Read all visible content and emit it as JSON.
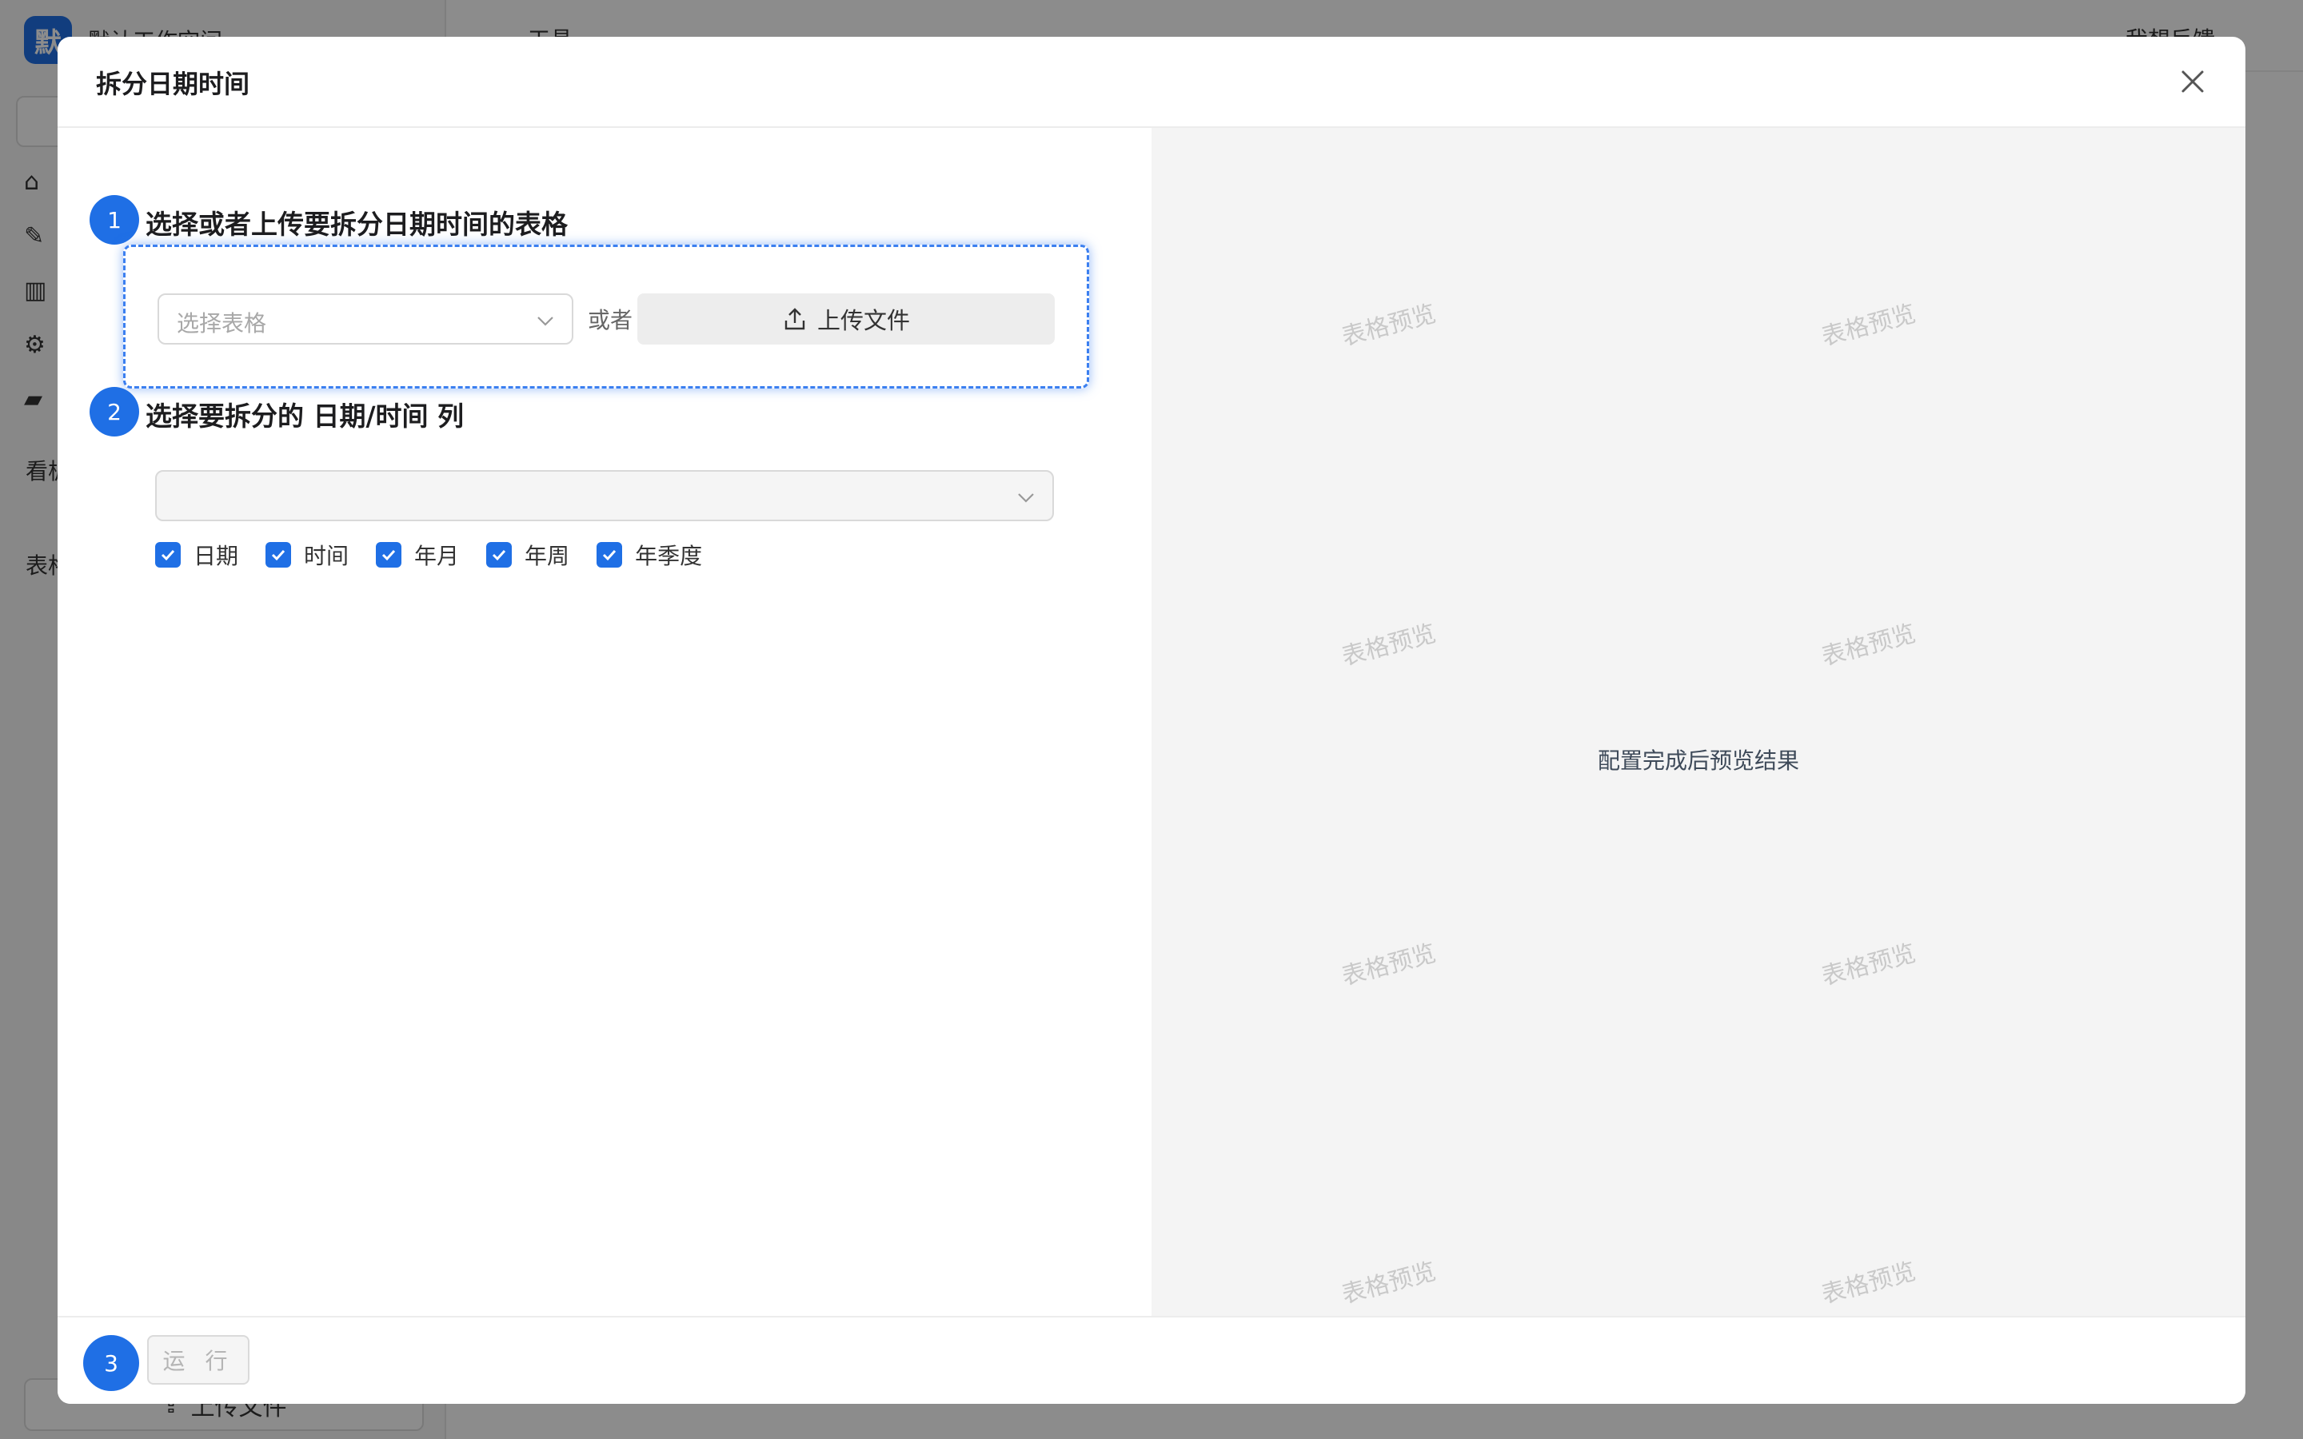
{
  "background": {
    "workspace_logo": "默",
    "workspace_name": "默认工作空间",
    "topbar_label": "工具",
    "feedback": "我想反馈",
    "section_boards": "看板",
    "section_tables": "表格",
    "bottom_upload": "上传文件"
  },
  "modal": {
    "title": "拆分日期时间",
    "step1": {
      "number": "1",
      "title": "选择或者上传要拆分日期时间的表格"
    },
    "select_table_placeholder": "选择表格",
    "or_text": "或者",
    "upload_button": "上传文件",
    "step2": {
      "number": "2",
      "title": "选择要拆分的 日期/时间 列"
    },
    "column_select_value": "",
    "checkboxes": [
      {
        "label": "日期",
        "checked": true
      },
      {
        "label": "时间",
        "checked": true
      },
      {
        "label": "年月",
        "checked": true
      },
      {
        "label": "年周",
        "checked": true
      },
      {
        "label": "年季度",
        "checked": true
      }
    ],
    "preview": {
      "watermark": "表格预览",
      "hint": "配置完成后预览结果"
    },
    "step3": {
      "number": "3"
    },
    "run_button": "运 行"
  },
  "colors": {
    "accent": "#1f6fe5",
    "preview_bg": "#f4f4f4",
    "overlay": "rgba(0,0,0,0.45)"
  }
}
